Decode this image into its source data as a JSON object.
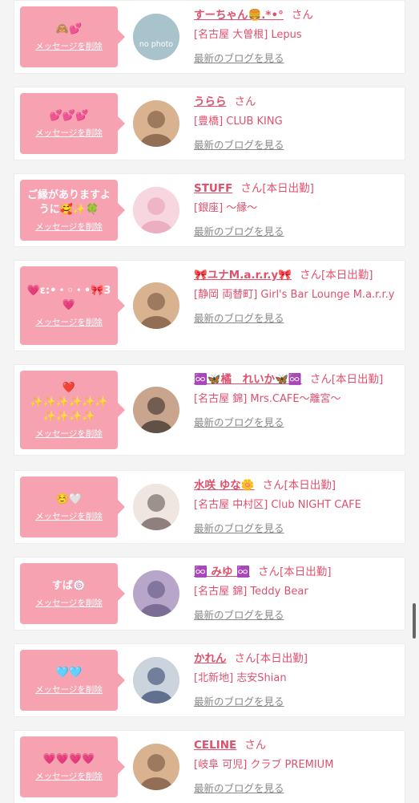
{
  "ui": {
    "delete_label": "メッセージを削除",
    "blog_label": "最新のブログを見る",
    "accent_color": "#f6a2b1",
    "text_color": "#e0506d"
  },
  "favorites": [
    {
      "message": "🙈💕",
      "name": "すーちゃん🍔.*•°",
      "suffix": "さん",
      "shop": "[名古屋 大曽根] Lepus",
      "avatar": "no-photo"
    },
    {
      "message": "💕💕💕",
      "name": "うらら",
      "suffix": "さん",
      "shop": "[豊橋] CLUB KING",
      "avatar": "photo"
    },
    {
      "message": "ご縁がありますように🥰✨🍀",
      "name": "STUFF",
      "suffix": "さん[本日出勤]",
      "shop": "[銀座] 〜縁〜",
      "avatar": "photo-pink"
    },
    {
      "message": "💗ε:•・◦・•🎀3💗",
      "name": "🎀ユナM.a.r.r.y🎀",
      "suffix": "さん[本日出勤]",
      "shop": "[静岡 両替町] Girl's Bar Lounge M.a.r.r.y",
      "avatar": "photo"
    },
    {
      "message": "❤️ ✨✨✨✨✨✨ ✨✨✨✨",
      "name": "♾️🦋橘　れいか🦋♾️",
      "suffix": "さん[本日出勤]",
      "shop": "[名古屋 錦] Mrs.CAFE〜離宮〜",
      "avatar": "photo-dark"
    },
    {
      "message": "☺️🤍",
      "name": "水咲 ゆな🌼",
      "suffix": "さん[本日出勤]",
      "shop": "[名古屋 中村区] Club NIGHT CAFE",
      "avatar": "photo-light"
    },
    {
      "message": "すば🍥",
      "name": "♾️ みゆ ♾️",
      "suffix": "さん[本日出勤]",
      "shop": "[名古屋 錦] Teddy Bear",
      "avatar": "photo-purple"
    },
    {
      "message": "🩵🩵",
      "name": "かれん",
      "suffix": "さん[本日出勤]",
      "shop": "[北新地] 志安Shian",
      "avatar": "photo-blue"
    },
    {
      "message": "💗💗💗💗",
      "name": "CELINE",
      "suffix": "さん",
      "shop": "[岐阜 可児] クラブ PREMIUM",
      "avatar": "photo"
    }
  ],
  "no_photo_text": "no photo"
}
